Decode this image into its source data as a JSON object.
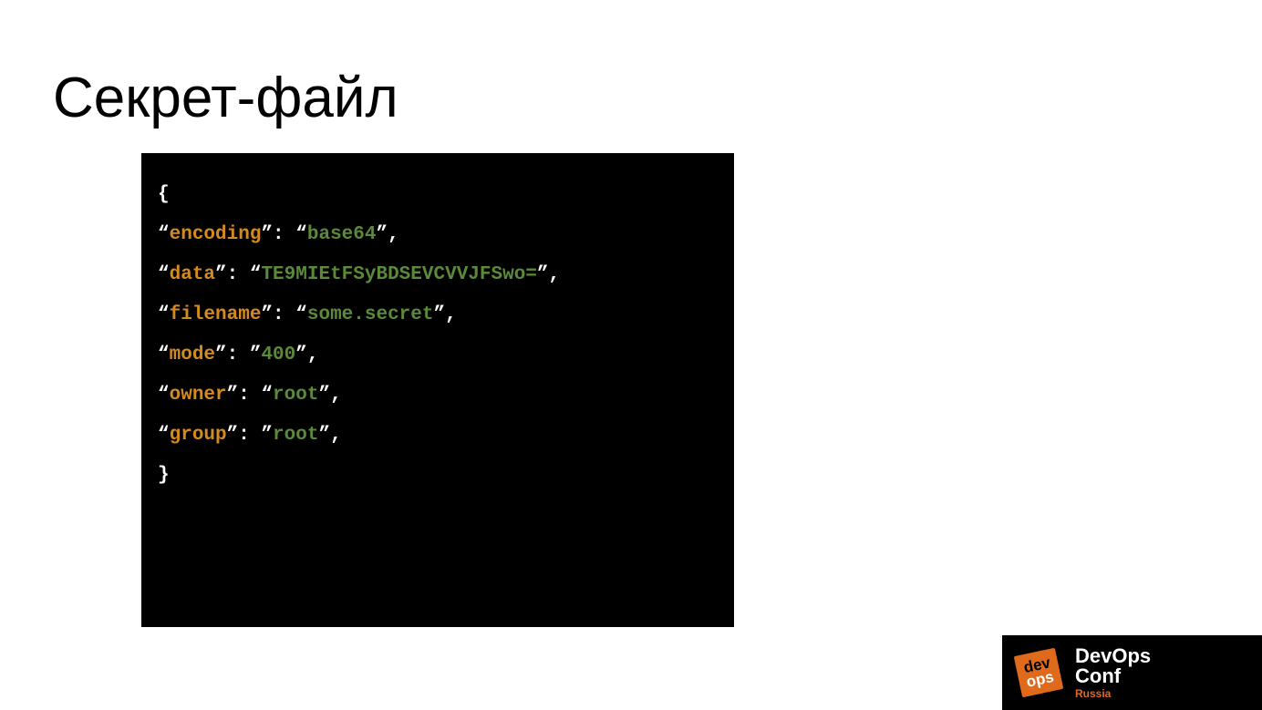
{
  "title": "Секрет-файл",
  "code": {
    "open": "{",
    "lines": [
      {
        "key": "encoding",
        "value": "base64"
      },
      {
        "key": "data",
        "value": "TE9MIEtFSyBDSEVCVVJFSwo="
      },
      {
        "key": "filename",
        "value": "some.secret"
      },
      {
        "key": "mode",
        "value": "400"
      },
      {
        "key": "owner",
        "value": "root"
      },
      {
        "key": "group",
        "value": "root"
      }
    ],
    "close": "}"
  },
  "footer": {
    "badge_l1": "dev",
    "badge_l2": "ops",
    "conf_l1": "DevOps",
    "conf_l2": "Conf",
    "conf_l3": "Russia"
  }
}
